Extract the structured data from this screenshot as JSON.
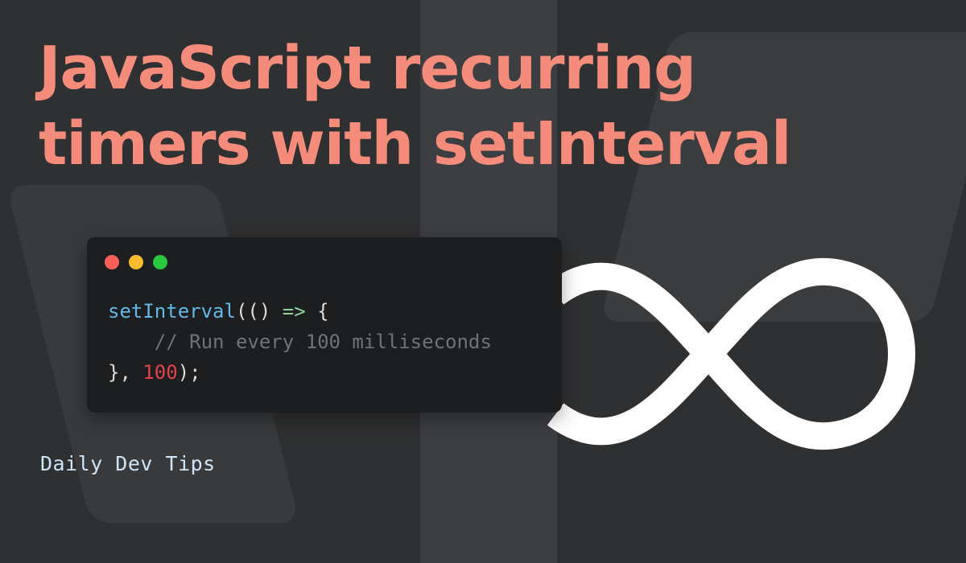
{
  "title": {
    "line1": "JavaScript recurring",
    "line2": "timers with setInterval"
  },
  "code": {
    "fn_name": "setInterval",
    "open_paren": "((",
    "close_paren_sp": ") ",
    "arrow": "=>",
    "brace_open": " {",
    "indent": "    ",
    "comment": "// Run every 100 milliseconds",
    "line3_start": "}, ",
    "delay": "100",
    "line3_end": ");"
  },
  "window_controls": {
    "close": "#fc5f57",
    "minimize": "#fdbc2e",
    "maximize": "#28c840"
  },
  "brand": {
    "label": "Daily Dev Tips"
  },
  "colors": {
    "background": "#2f3031",
    "title": "#f58c7b",
    "code_background": "#1d1e20",
    "function": "#63b8e6",
    "number": "#e0434c",
    "comment": "#6f7377",
    "brand": "#cfe4f7",
    "infinity": "#ffffff"
  },
  "icons": [
    "infinity-icon"
  ]
}
